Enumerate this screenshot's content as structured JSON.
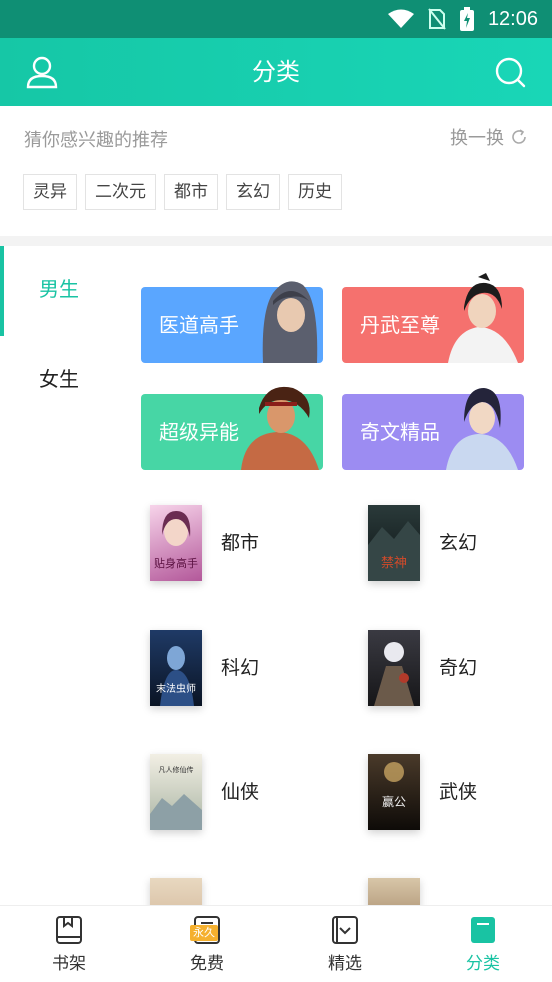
{
  "status_bar": {
    "time": "12:06"
  },
  "app_bar": {
    "title": "分类",
    "user_icon": "user-icon",
    "search_icon": "search-icon"
  },
  "recommend": {
    "hint": "猜你感兴趣的推荐",
    "refresh_label": "换一换",
    "tags": [
      "灵异",
      "二次元",
      "都市",
      "玄幻",
      "历史"
    ]
  },
  "gender_tabs": [
    "男生",
    "女生"
  ],
  "active_gender": "男生",
  "featured_cards": [
    {
      "label": "医道高手",
      "color": "#5aa6ff"
    },
    {
      "label": "丹武至尊",
      "color": "#f5716e"
    },
    {
      "label": "超级异能",
      "color": "#47d6a5"
    },
    {
      "label": "奇文精品",
      "color": "#9c8cf2"
    }
  ],
  "categories": [
    {
      "name": "都市",
      "cover_text": "贴身高手"
    },
    {
      "name": "玄幻",
      "cover_text": "禁神"
    },
    {
      "name": "科幻",
      "cover_text": "末法虫师"
    },
    {
      "name": "奇幻",
      "cover_text": ""
    },
    {
      "name": "仙侠",
      "cover_text": "凡人修仙传"
    },
    {
      "name": "武侠",
      "cover_text": "赢公"
    }
  ],
  "bottom_tabs": [
    {
      "label": "书架",
      "icon": "bookshelf-icon"
    },
    {
      "label": "免费",
      "icon": "free-icon",
      "badge": "永久"
    },
    {
      "label": "精选",
      "icon": "featured-icon"
    },
    {
      "label": "分类",
      "icon": "category-icon"
    }
  ],
  "active_tab": "分类",
  "colors": {
    "accent": "#19c3a3",
    "header": "#16c7a6",
    "status_bar": "#0f8f74"
  }
}
